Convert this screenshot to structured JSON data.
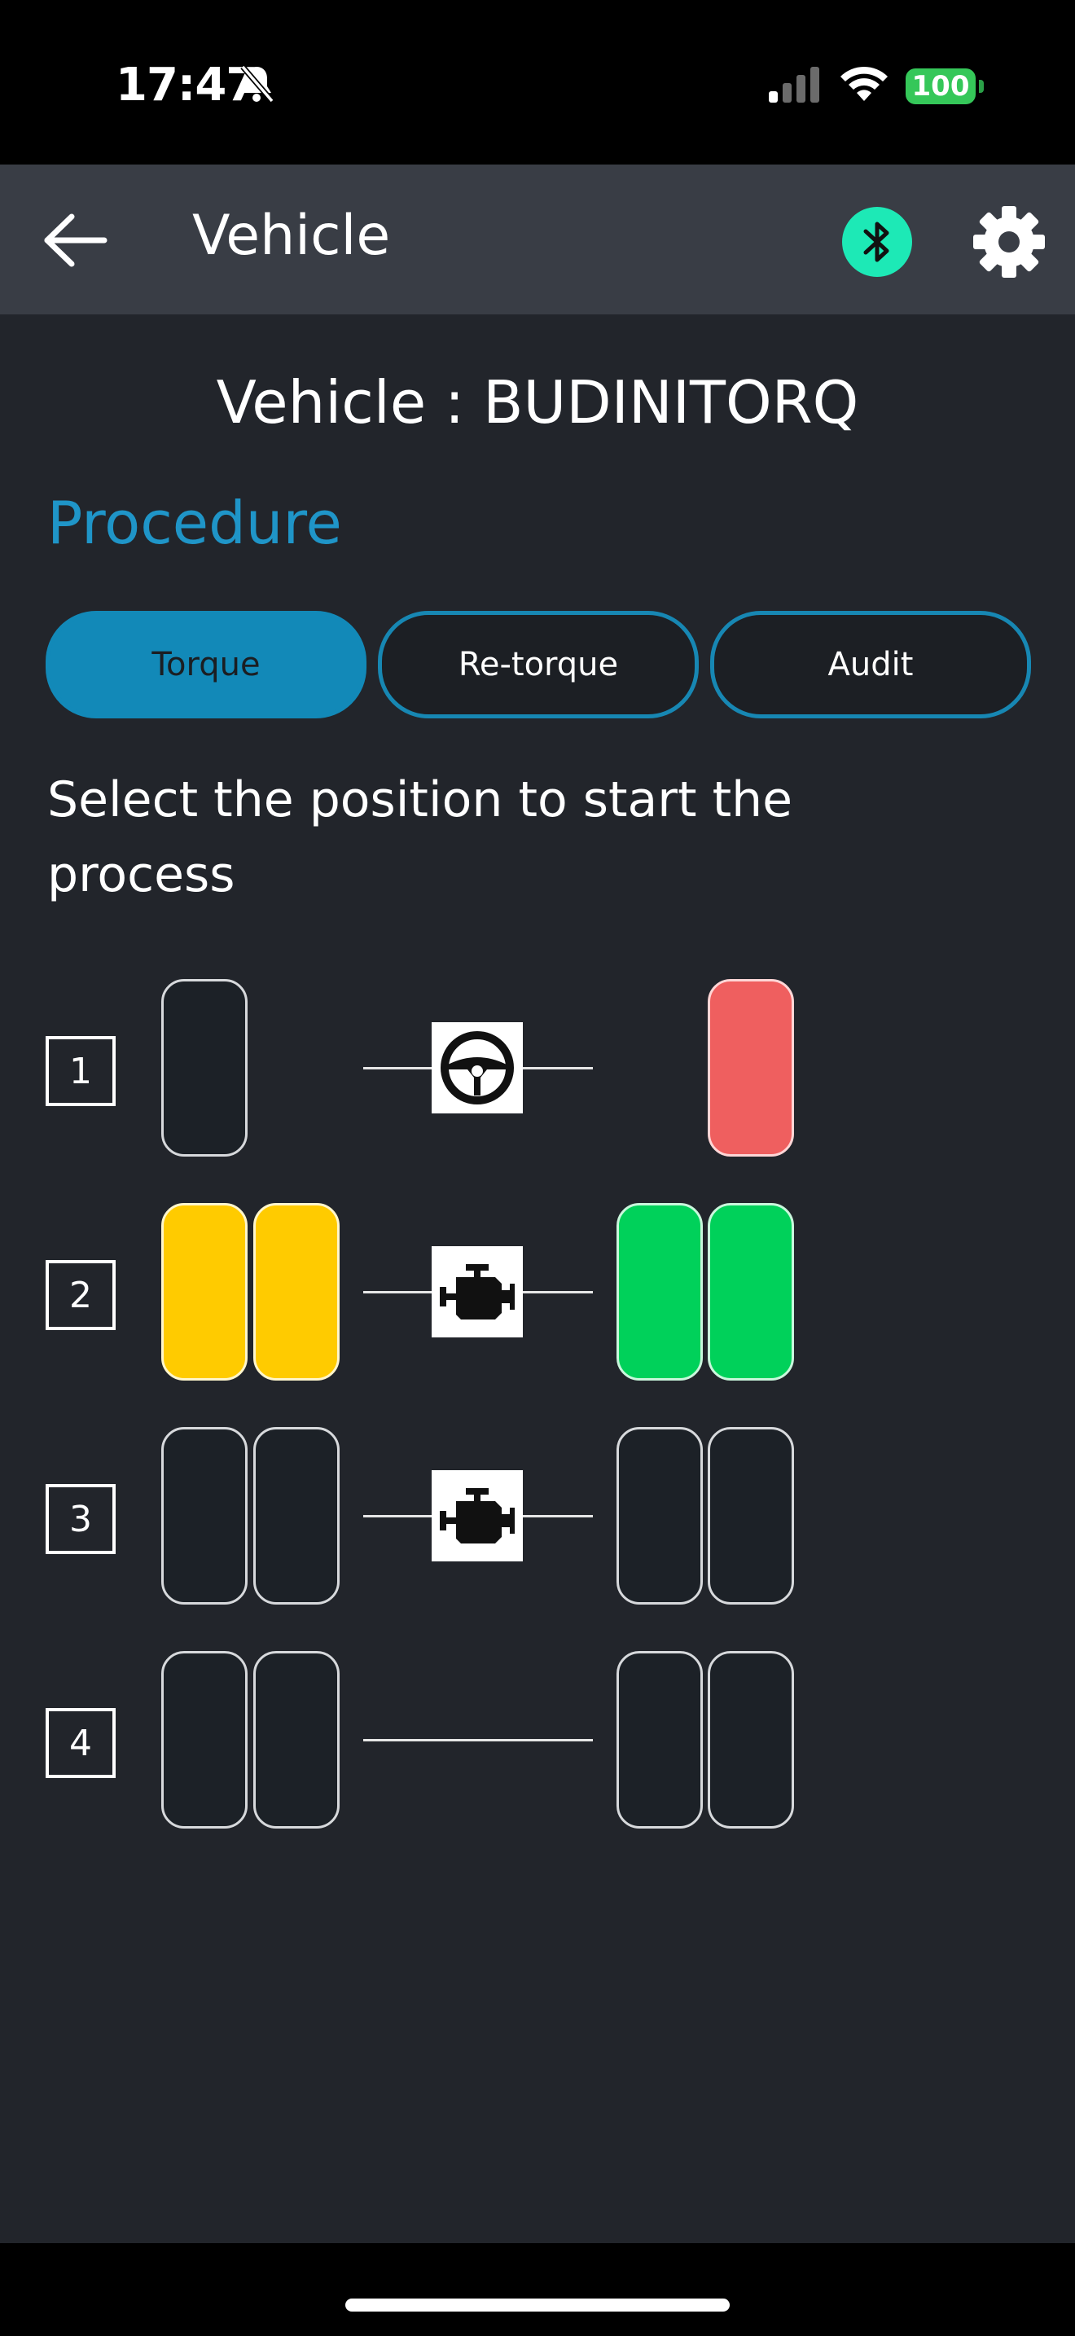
{
  "status_bar": {
    "time": "17:47",
    "battery": "100",
    "icons": [
      "bell-slash-icon",
      "cellular-signal-icon",
      "wifi-icon",
      "battery-icon"
    ]
  },
  "app_bar": {
    "title": "Vehicle",
    "icons": [
      "back-arrow-icon",
      "bluetooth-icon",
      "gear-icon"
    ],
    "accent": "#1de9b6"
  },
  "vehicle": {
    "label": "Vehicle : ",
    "name": "BUDINITORQ"
  },
  "procedure": {
    "heading": "Procedure",
    "tabs": [
      {
        "label": "Torque",
        "active": true
      },
      {
        "label": "Re-torque",
        "active": false
      },
      {
        "label": "Audit",
        "active": false
      }
    ]
  },
  "instruction": "Select the position to start the process",
  "colors": {
    "background": "#22252b",
    "appbar": "#393d45",
    "accent_blue": "#1f95c8",
    "status_yellow": "#ffcb00",
    "status_green": "#00d15a",
    "status_red": "#ef5f5f"
  },
  "axles": [
    {
      "number": "1",
      "center_icon": "steering-wheel-icon",
      "left_tires": [
        "empty"
      ],
      "right_tires": [
        "red"
      ]
    },
    {
      "number": "2",
      "center_icon": "engine-icon",
      "left_tires": [
        "yellow",
        "yellow"
      ],
      "right_tires": [
        "green",
        "green"
      ]
    },
    {
      "number": "3",
      "center_icon": "engine-icon",
      "left_tires": [
        "empty",
        "empty"
      ],
      "right_tires": [
        "empty",
        "empty"
      ]
    },
    {
      "number": "4",
      "center_icon": "",
      "left_tires": [
        "empty",
        "empty"
      ],
      "right_tires": [
        "empty",
        "empty"
      ]
    }
  ]
}
